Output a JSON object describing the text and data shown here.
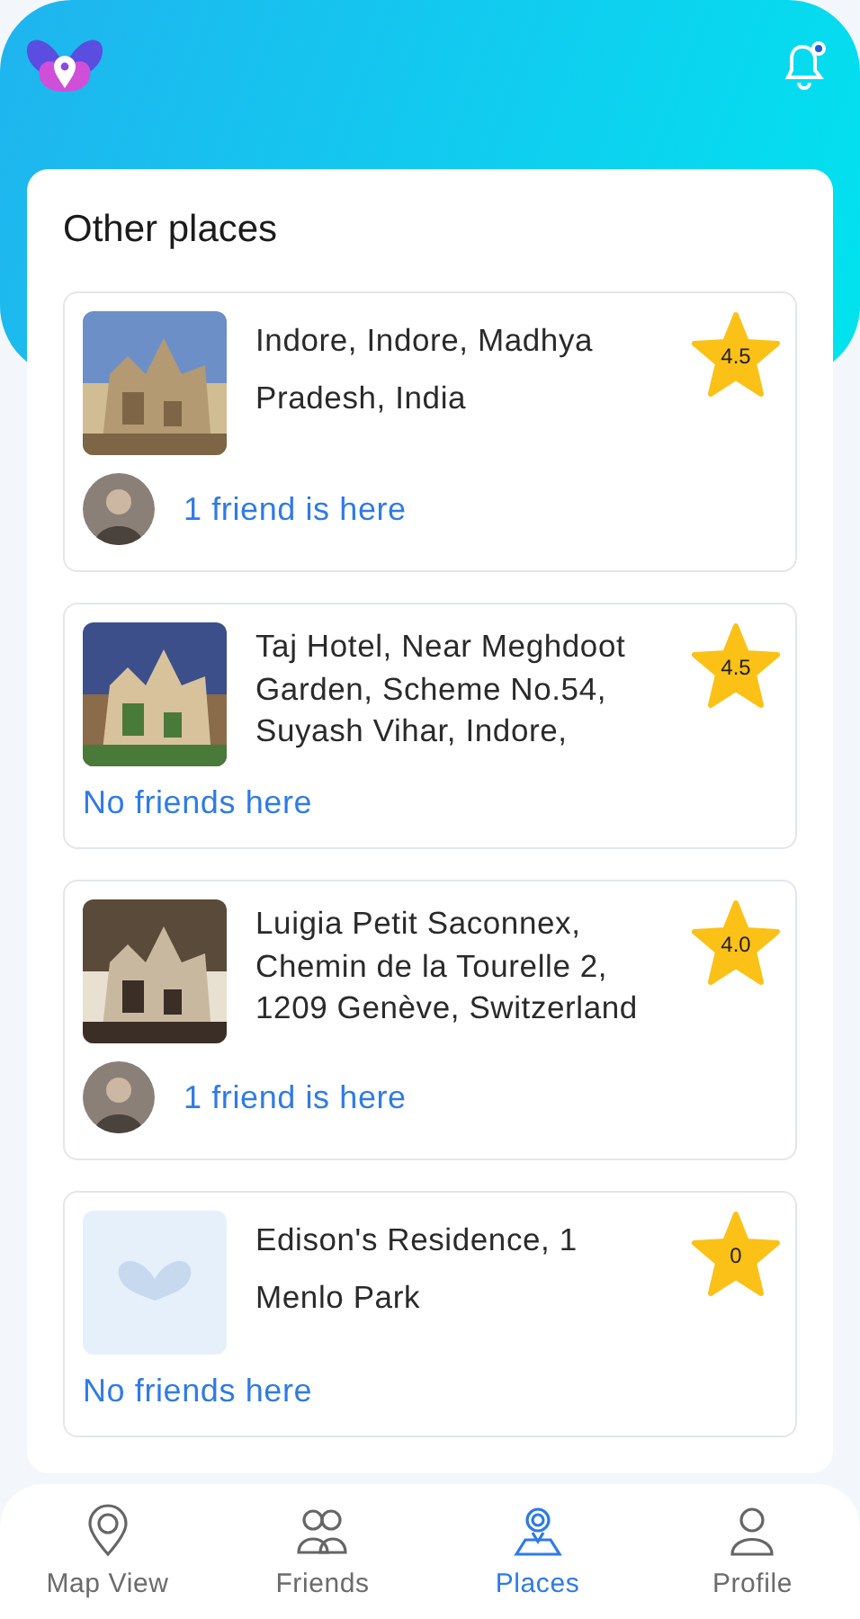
{
  "header": {
    "notification_dot": true
  },
  "section_title": "Other places",
  "places": [
    {
      "name": "Indore, Indore, Madhya Pradesh, India",
      "rating": "4.5",
      "friends": "1 friend is here",
      "friend_avatar": true
    },
    {
      "name": "Taj Hotel, Near Meghdoot Garden, Scheme No.54, Suyash Vihar, Indore,",
      "rating": "4.5",
      "friends": "No friends here",
      "friend_avatar": false
    },
    {
      "name": "Luigia Petit Saconnex, Chemin de la Tourelle 2, 1209 Genève, Switzerland",
      "rating": "4.0",
      "friends": "1 friend is here",
      "friend_avatar": true
    },
    {
      "name": "Edison's Residence, 1 Menlo Park",
      "kind": "placeholder",
      "rating": "0",
      "friends": "No friends here",
      "friend_avatar": false
    }
  ],
  "nav": [
    {
      "label": "Map View",
      "kind": "pin",
      "selected": false
    },
    {
      "label": "Friends",
      "kind": "friends",
      "selected": false
    },
    {
      "label": "Places",
      "kind": "places",
      "selected": true
    },
    {
      "label": "Profile",
      "kind": "profile",
      "selected": false
    }
  ]
}
